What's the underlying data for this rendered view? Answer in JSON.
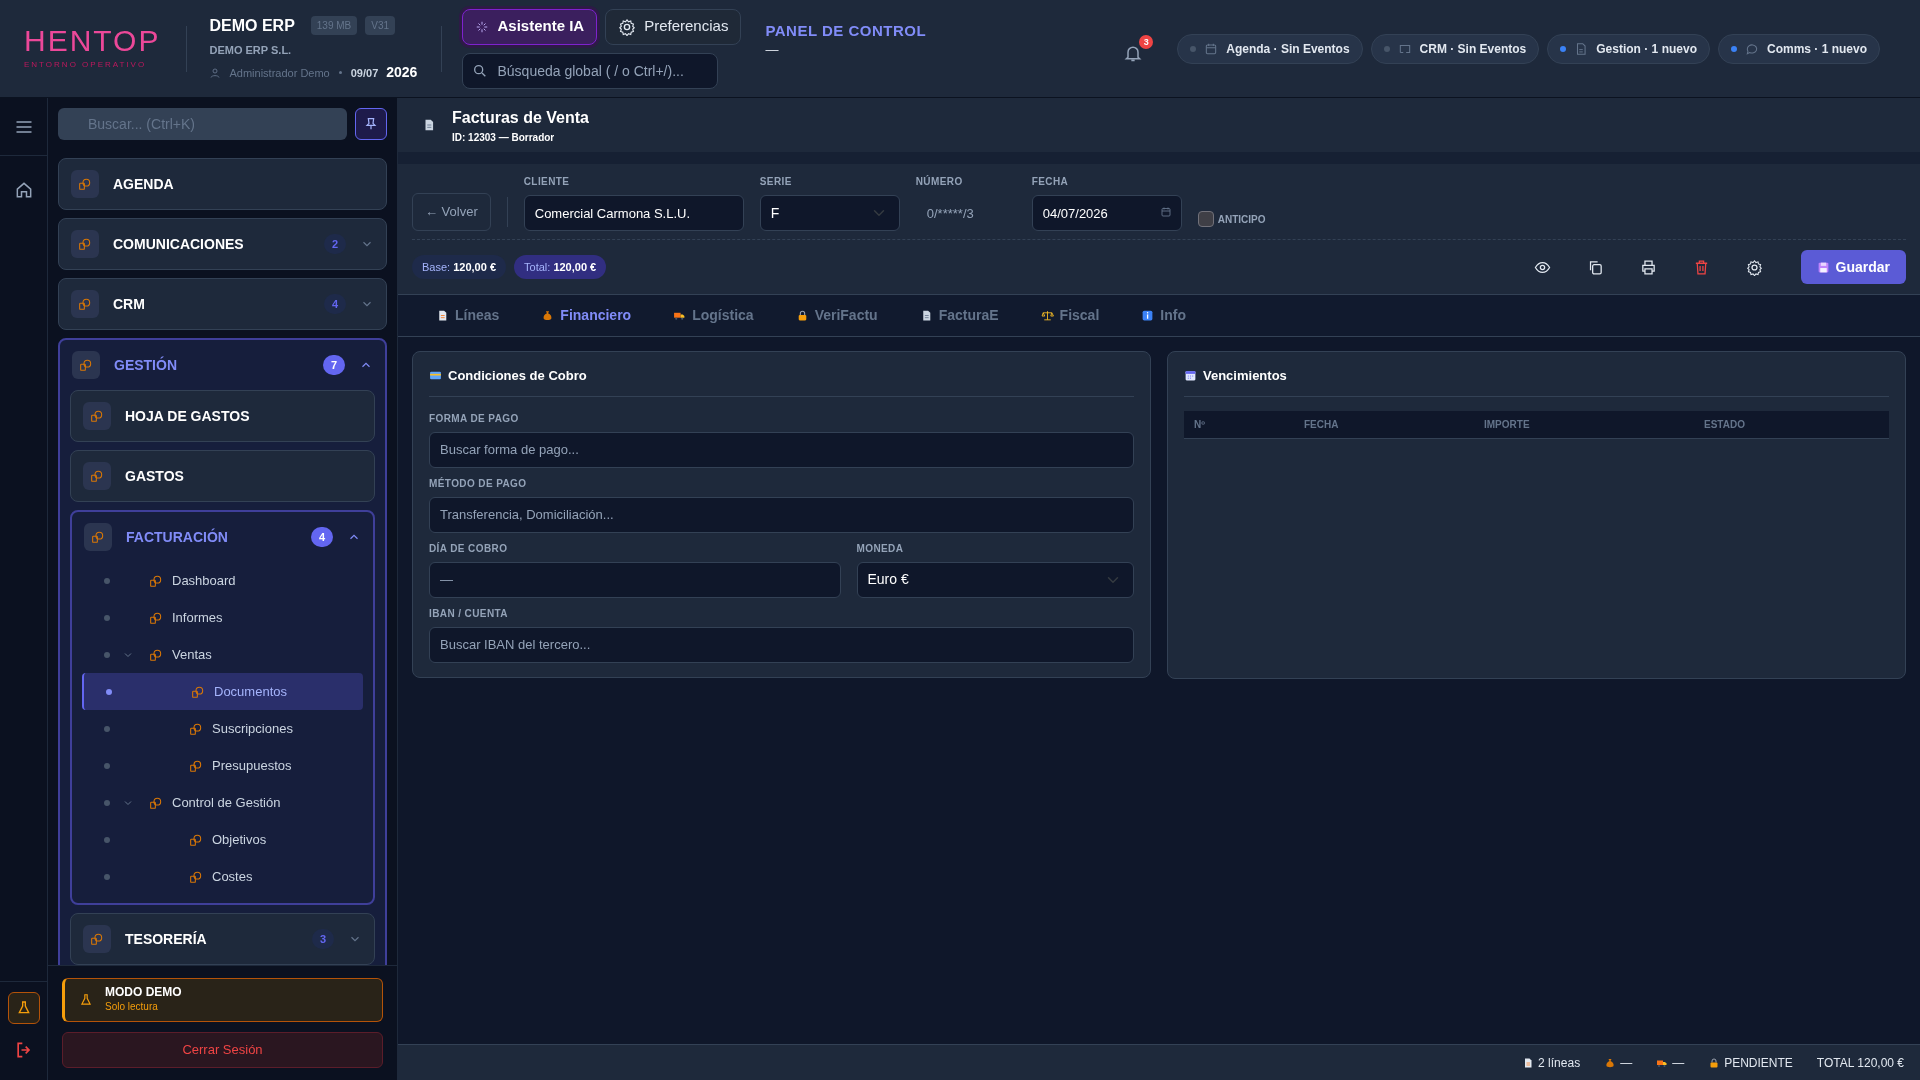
{
  "brand": {
    "logo": "HENTOP",
    "tagline": "ENTORNO OPERATIVO"
  },
  "company": {
    "name": "DEMO ERP",
    "memory": "139 MB",
    "version": "V31",
    "legal_name": "DEMO ERP S.L.",
    "user": "Administrador Demo",
    "date": "09/07",
    "year": "2026"
  },
  "top_buttons": [
    {
      "label": "Asistente IA",
      "selected": true
    },
    {
      "label": "Preferencias",
      "selected": false
    }
  ],
  "global_search": {
    "placeholder": "Búsqueda global ( / o Ctrl+/)..."
  },
  "panel": {
    "title": "PANEL DE CONTROL",
    "subtitle": "—"
  },
  "notifications": {
    "count": "3"
  },
  "status_pills": [
    {
      "kind": "calendar",
      "label": "Agenda · Sin Eventos",
      "color": "#475569"
    },
    {
      "kind": "monitor",
      "label": "CRM · Sin Eventos",
      "color": "#475569"
    },
    {
      "kind": "document",
      "label": "Gestion · 1 nuevo",
      "color": "#3b82f6"
    },
    {
      "kind": "chat",
      "label": "Comms · 1 nuevo",
      "color": "#3b82f6"
    }
  ],
  "sidebar": {
    "search": {
      "placeholder": "Buscar... (Ctrl+K)"
    },
    "sections": [
      {
        "label": "AGENDA"
      },
      {
        "label": "COMUNICACIONES",
        "badge": "2",
        "expanded": false
      },
      {
        "label": "CRM",
        "badge": "4",
        "expanded": false
      },
      {
        "label": "GESTIÓN",
        "badge": "7",
        "expanded": true,
        "children": [
          {
            "label": "HOJA DE GASTOS"
          },
          {
            "label": "GASTOS"
          },
          {
            "label": "FACTURACIÓN",
            "badge": "4",
            "expanded": true,
            "children": [
              {
                "label": "Dashboard",
                "selected": false
              },
              {
                "label": "Informes",
                "selected": false
              },
              {
                "label": "Ventas",
                "selected": false,
                "expanded": true,
                "children": [
                  {
                    "label": "Documentos",
                    "selected": true
                  },
                  {
                    "label": "Suscripciones",
                    "selected": false
                  },
                  {
                    "label": "Presupuestos",
                    "selected": false
                  }
                ]
              },
              {
                "label": "Control de Gestión",
                "selected": false,
                "expanded": true,
                "children": [
                  {
                    "label": "Objetivos",
                    "selected": false
                  },
                  {
                    "label": "Costes",
                    "selected": false
                  }
                ]
              }
            ]
          },
          {
            "label": "TESORERÍA",
            "badge": "3",
            "expanded": false
          }
        ]
      }
    ],
    "demo": {
      "title": "MODO DEMO",
      "subtitle": "Solo lectura"
    },
    "logout": "Cerrar Sesión"
  },
  "document": {
    "title": "Facturas de Venta",
    "subtitle": "ID: 12303 — Borrador"
  },
  "form": {
    "back": "← Volver",
    "fields": [
      {
        "kind": "text",
        "label": "CLIENTE",
        "value": "Comercial Carmona S.L.U."
      },
      {
        "kind": "select",
        "label": "SERIE",
        "value": "F"
      },
      {
        "kind": "readonly",
        "label": "NÚMERO",
        "placeholder": "0/*****/3"
      },
      {
        "kind": "date",
        "label": "FECHA",
        "value": "04/07/2026"
      },
      {
        "kind": "checkbox",
        "label": "ANTICIPO",
        "checked": false
      }
    ]
  },
  "totals": [
    {
      "label": "Base:",
      "value": "120,00 €"
    },
    {
      "label": "Total:",
      "value": "120,00 €"
    }
  ],
  "save": "Guardar",
  "tabs": [
    {
      "label": "Líneas",
      "selected": false
    },
    {
      "label": "Financiero",
      "selected": true
    },
    {
      "label": "Logística",
      "selected": false
    },
    {
      "label": "VeriFactu",
      "selected": false
    },
    {
      "label": "FacturaE",
      "selected": false
    },
    {
      "label": "Fiscal",
      "selected": false
    },
    {
      "label": "Info",
      "selected": false
    }
  ],
  "payment": {
    "title": "Condiciones de Cobro",
    "rows": [
      {
        "fields": [
          {
            "kind": "text",
            "label": "FORMA DE PAGO",
            "placeholder": "Buscar forma de pago..."
          }
        ]
      },
      {
        "fields": [
          {
            "kind": "text",
            "label": "MÉTODO DE PAGO",
            "placeholder": "Transferencia, Domiciliación..."
          }
        ]
      },
      {
        "fields": [
          {
            "kind": "text",
            "label": "DÍA DE COBRO",
            "placeholder": "—"
          },
          {
            "kind": "select",
            "label": "MONEDA",
            "value": "Euro €"
          }
        ]
      },
      {
        "fields": [
          {
            "kind": "text",
            "label": "IBAN / CUENTA",
            "placeholder": "Buscar IBAN del tercero..."
          }
        ]
      }
    ]
  },
  "schedule": {
    "title": "Vencimientos",
    "columns": [
      "Nº",
      "FECHA",
      "IMPORTE",
      "ESTADO"
    ]
  },
  "status_bar": [
    {
      "text": "2 líneas"
    },
    {
      "text": "—"
    },
    {
      "text": "—"
    },
    {
      "text": "PENDIENTE"
    },
    {
      "text": "TOTAL 120,00 €"
    }
  ]
}
